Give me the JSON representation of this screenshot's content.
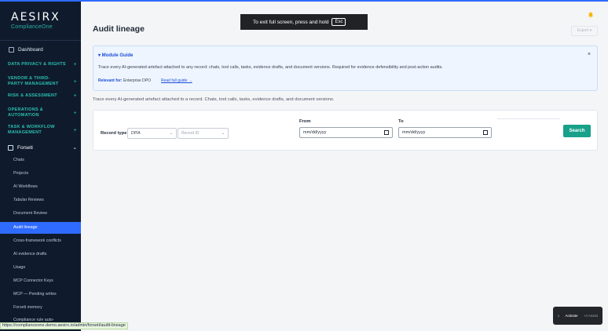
{
  "app": {
    "brand": "AESIRX",
    "brand_sub": "ComplianceOne"
  },
  "sidebar": {
    "dashboard": "Dashboard",
    "sections": [
      {
        "label": "DATA PRIVACY & RIGHTS"
      },
      {
        "label": "VENDOR & THIRD-PARTY MANAGEMENT"
      },
      {
        "label": "RISK & ASSESSMENT"
      },
      {
        "label": "OPERATIONS & AUTOMATION"
      },
      {
        "label": "TASK & WORKFLOW MANAGEMENT"
      }
    ],
    "forseti": "Forseti",
    "items": [
      {
        "label": "Chats"
      },
      {
        "label": "Projects"
      },
      {
        "label": "AI Workflows"
      },
      {
        "label": "Tabular Reviews"
      },
      {
        "label": "Document Review"
      },
      {
        "label": "Audit lineage"
      },
      {
        "label": "Cross-framework conflicts"
      },
      {
        "label": "AI evidence drafts"
      },
      {
        "label": "Usage"
      },
      {
        "label": "MCP Connector Keys"
      },
      {
        "label": "MCP — Pending writes"
      },
      {
        "label": "Forseti memory"
      },
      {
        "label": "Compliance rule auto-"
      }
    ]
  },
  "header": {
    "title": "Audit lineage",
    "export": "Export ▾"
  },
  "toast": {
    "text": "To exit full screen, press and hold",
    "key": "Esc"
  },
  "guide": {
    "title": "▾  Module Guide",
    "close": "×",
    "text": "Trace every AI-generated artefact attached to any record: chats, tool calls, tasks, evidence drafts, and document versions. Required for evidence defensibility and post-action audits.",
    "relevant_label": "Relevant for:",
    "relevant_value": "Enterprise DPO",
    "read_more": "Read full guide →"
  },
  "description": "Trace every AI-generated artefact attached to a record. Chats, tool calls, tasks, evidence drafts, and document versions.",
  "filters": {
    "record_type_label": "Record type",
    "record_type_value": "DPIA",
    "record_id_placeholder": "Record ID",
    "from_label": "From",
    "to_label": "To",
    "from_value": "mm/dd/yyyy",
    "to_value": "mm/dd/yyyy",
    "search_button": "Search"
  },
  "widget": {
    "close": "x",
    "activate": "Activate",
    "status": "+4 Assist"
  },
  "statusbar": {
    "url": "https://complianceone.demo.aesirx.io/admin/forseti/audit-lineage"
  }
}
